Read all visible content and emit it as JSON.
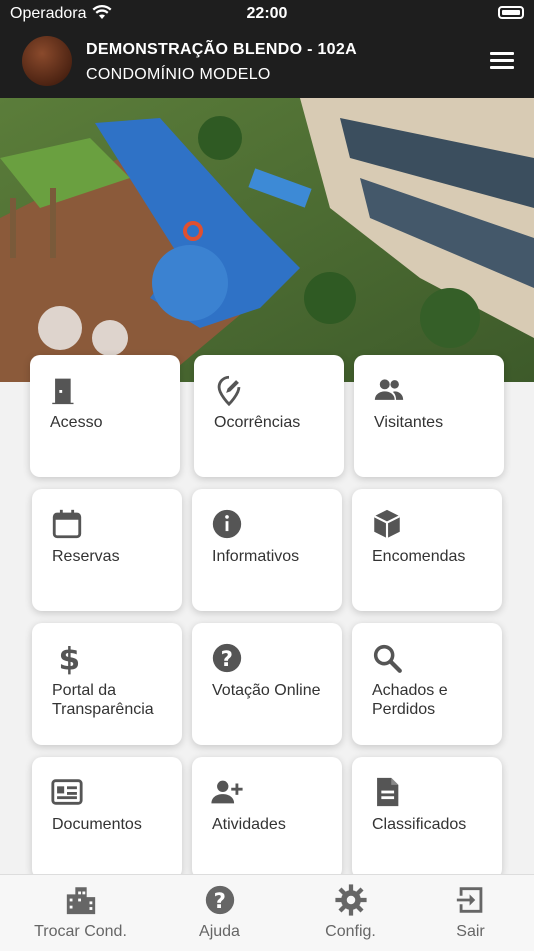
{
  "status_bar": {
    "carrier": "Operadora",
    "time": "22:00"
  },
  "header": {
    "title": "DEMONSTRAÇÃO BLENDO - 102A",
    "subtitle": "CONDOMÍNIO MODELO"
  },
  "menu": [
    {
      "label": "Acesso",
      "icon": "door-icon"
    },
    {
      "label": "Ocorrências",
      "icon": "edit-pin-icon"
    },
    {
      "label": "Visitantes",
      "icon": "people-icon"
    },
    {
      "label": "Reservas",
      "icon": "calendar-icon"
    },
    {
      "label": "Informativos",
      "icon": "info-icon"
    },
    {
      "label": "Encomendas",
      "icon": "package-icon"
    },
    {
      "label": "Portal da Transparência",
      "icon": "dollar-icon"
    },
    {
      "label": "Votação Online",
      "icon": "question-icon"
    },
    {
      "label": "Achados e Perdidos",
      "icon": "search-icon"
    },
    {
      "label": "Documentos",
      "icon": "newspaper-icon"
    },
    {
      "label": "Atividades",
      "icon": "person-add-icon"
    },
    {
      "label": "Classificados",
      "icon": "file-icon"
    }
  ],
  "tabs": [
    {
      "label": "Trocar Cond.",
      "icon": "building-icon"
    },
    {
      "label": "Ajuda",
      "icon": "help-icon"
    },
    {
      "label": "Config.",
      "icon": "gear-icon"
    },
    {
      "label": "Sair",
      "icon": "exit-icon"
    }
  ],
  "colors": {
    "header_bg": "#1e1e1e",
    "icon": "#555555",
    "background": "#f2f2f2"
  }
}
